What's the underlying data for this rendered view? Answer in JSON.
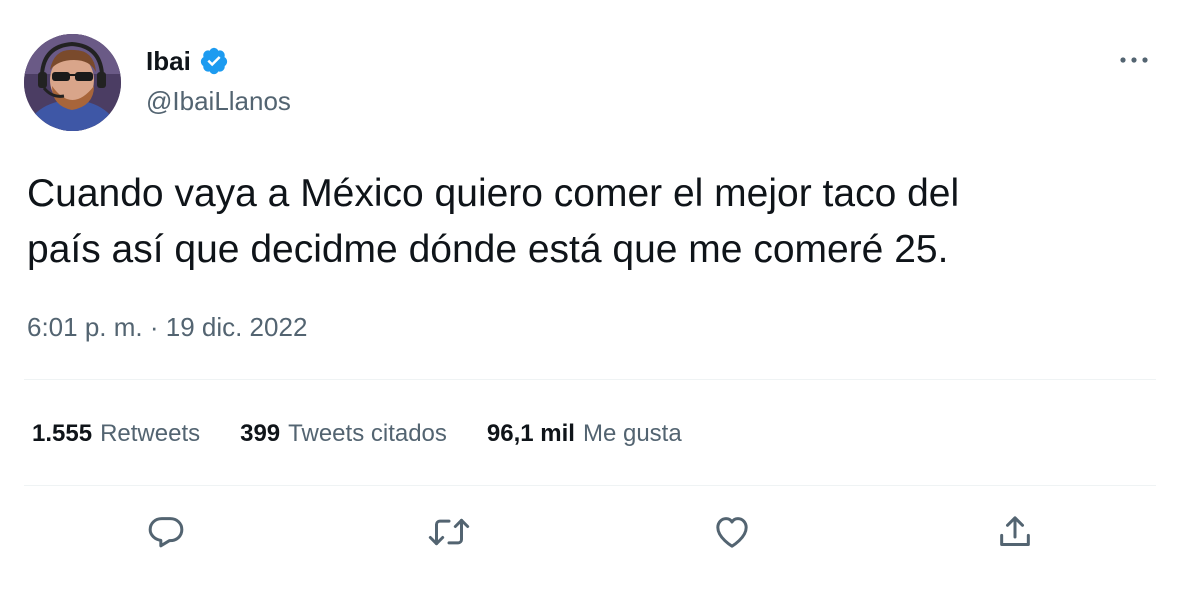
{
  "author": {
    "display_name": "Ibai",
    "handle": "@IbaiLlanos",
    "verified": true
  },
  "tweet": {
    "text_line1": "Cuando vaya a México quiero comer el mejor taco del",
    "text_line2": "país así que decidme dónde está que me comeré 25."
  },
  "timestamp": {
    "time": "6:01 p. m.",
    "separator": " · ",
    "date": "19 dic. 2022"
  },
  "stats": [
    {
      "value": "1.555",
      "label": "Retweets"
    },
    {
      "value": "399",
      "label": "Tweets citados"
    },
    {
      "value": "96,1 mil",
      "label": "Me gusta"
    }
  ],
  "actions": [
    "reply-icon",
    "retweet-icon",
    "like-icon",
    "share-icon"
  ],
  "colors": {
    "text": "#0f1419",
    "secondary": "#536471",
    "verified": "#1d9bf0",
    "divider": "#eff3f4"
  }
}
